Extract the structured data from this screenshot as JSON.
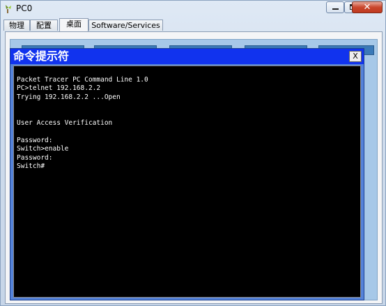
{
  "window": {
    "title": "PC0",
    "icon": "pc-icon",
    "buttons": {
      "minimize": "minimize-icon",
      "maximize": "maximize-icon",
      "close_label": "✕"
    }
  },
  "tabs": [
    {
      "label": "物理",
      "active": false
    },
    {
      "label": "配置",
      "active": false
    },
    {
      "label": "桌面",
      "active": true
    },
    {
      "label": "Software/Services",
      "active": false
    }
  ],
  "command_prompt": {
    "title": "命令提示符",
    "close_label": "X",
    "lines": [
      "Packet Tracer PC Command Line 1.0",
      "PC>telnet 192.168.2.2",
      "Trying 192.168.2.2 ...Open",
      "",
      "",
      "User Access Verification",
      "",
      "Password:",
      "Switch>enable",
      "Password:",
      "Switch#"
    ]
  },
  "colors": {
    "cmd_title_bar": "#1133ee",
    "terminal_bg": "#000000",
    "terminal_fg": "#ffffff",
    "desktop_bg": "#a6c8e8"
  }
}
